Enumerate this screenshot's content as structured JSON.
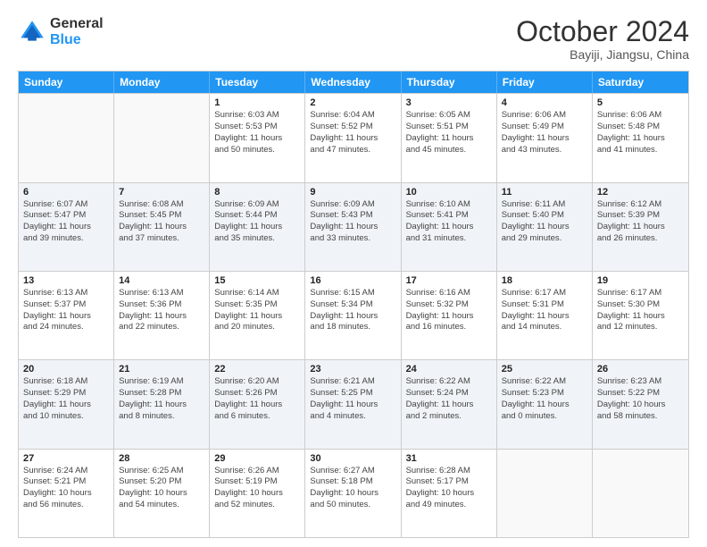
{
  "logo": {
    "line1": "General",
    "line2": "Blue"
  },
  "title": "October 2024",
  "subtitle": "Bayiji, Jiangsu, China",
  "header_days": [
    "Sunday",
    "Monday",
    "Tuesday",
    "Wednesday",
    "Thursday",
    "Friday",
    "Saturday"
  ],
  "weeks": [
    [
      {
        "day": "",
        "lines": []
      },
      {
        "day": "",
        "lines": []
      },
      {
        "day": "1",
        "lines": [
          "Sunrise: 6:03 AM",
          "Sunset: 5:53 PM",
          "Daylight: 11 hours",
          "and 50 minutes."
        ]
      },
      {
        "day": "2",
        "lines": [
          "Sunrise: 6:04 AM",
          "Sunset: 5:52 PM",
          "Daylight: 11 hours",
          "and 47 minutes."
        ]
      },
      {
        "day": "3",
        "lines": [
          "Sunrise: 6:05 AM",
          "Sunset: 5:51 PM",
          "Daylight: 11 hours",
          "and 45 minutes."
        ]
      },
      {
        "day": "4",
        "lines": [
          "Sunrise: 6:06 AM",
          "Sunset: 5:49 PM",
          "Daylight: 11 hours",
          "and 43 minutes."
        ]
      },
      {
        "day": "5",
        "lines": [
          "Sunrise: 6:06 AM",
          "Sunset: 5:48 PM",
          "Daylight: 11 hours",
          "and 41 minutes."
        ]
      }
    ],
    [
      {
        "day": "6",
        "lines": [
          "Sunrise: 6:07 AM",
          "Sunset: 5:47 PM",
          "Daylight: 11 hours",
          "and 39 minutes."
        ]
      },
      {
        "day": "7",
        "lines": [
          "Sunrise: 6:08 AM",
          "Sunset: 5:45 PM",
          "Daylight: 11 hours",
          "and 37 minutes."
        ]
      },
      {
        "day": "8",
        "lines": [
          "Sunrise: 6:09 AM",
          "Sunset: 5:44 PM",
          "Daylight: 11 hours",
          "and 35 minutes."
        ]
      },
      {
        "day": "9",
        "lines": [
          "Sunrise: 6:09 AM",
          "Sunset: 5:43 PM",
          "Daylight: 11 hours",
          "and 33 minutes."
        ]
      },
      {
        "day": "10",
        "lines": [
          "Sunrise: 6:10 AM",
          "Sunset: 5:41 PM",
          "Daylight: 11 hours",
          "and 31 minutes."
        ]
      },
      {
        "day": "11",
        "lines": [
          "Sunrise: 6:11 AM",
          "Sunset: 5:40 PM",
          "Daylight: 11 hours",
          "and 29 minutes."
        ]
      },
      {
        "day": "12",
        "lines": [
          "Sunrise: 6:12 AM",
          "Sunset: 5:39 PM",
          "Daylight: 11 hours",
          "and 26 minutes."
        ]
      }
    ],
    [
      {
        "day": "13",
        "lines": [
          "Sunrise: 6:13 AM",
          "Sunset: 5:37 PM",
          "Daylight: 11 hours",
          "and 24 minutes."
        ]
      },
      {
        "day": "14",
        "lines": [
          "Sunrise: 6:13 AM",
          "Sunset: 5:36 PM",
          "Daylight: 11 hours",
          "and 22 minutes."
        ]
      },
      {
        "day": "15",
        "lines": [
          "Sunrise: 6:14 AM",
          "Sunset: 5:35 PM",
          "Daylight: 11 hours",
          "and 20 minutes."
        ]
      },
      {
        "day": "16",
        "lines": [
          "Sunrise: 6:15 AM",
          "Sunset: 5:34 PM",
          "Daylight: 11 hours",
          "and 18 minutes."
        ]
      },
      {
        "day": "17",
        "lines": [
          "Sunrise: 6:16 AM",
          "Sunset: 5:32 PM",
          "Daylight: 11 hours",
          "and 16 minutes."
        ]
      },
      {
        "day": "18",
        "lines": [
          "Sunrise: 6:17 AM",
          "Sunset: 5:31 PM",
          "Daylight: 11 hours",
          "and 14 minutes."
        ]
      },
      {
        "day": "19",
        "lines": [
          "Sunrise: 6:17 AM",
          "Sunset: 5:30 PM",
          "Daylight: 11 hours",
          "and 12 minutes."
        ]
      }
    ],
    [
      {
        "day": "20",
        "lines": [
          "Sunrise: 6:18 AM",
          "Sunset: 5:29 PM",
          "Daylight: 11 hours",
          "and 10 minutes."
        ]
      },
      {
        "day": "21",
        "lines": [
          "Sunrise: 6:19 AM",
          "Sunset: 5:28 PM",
          "Daylight: 11 hours",
          "and 8 minutes."
        ]
      },
      {
        "day": "22",
        "lines": [
          "Sunrise: 6:20 AM",
          "Sunset: 5:26 PM",
          "Daylight: 11 hours",
          "and 6 minutes."
        ]
      },
      {
        "day": "23",
        "lines": [
          "Sunrise: 6:21 AM",
          "Sunset: 5:25 PM",
          "Daylight: 11 hours",
          "and 4 minutes."
        ]
      },
      {
        "day": "24",
        "lines": [
          "Sunrise: 6:22 AM",
          "Sunset: 5:24 PM",
          "Daylight: 11 hours",
          "and 2 minutes."
        ]
      },
      {
        "day": "25",
        "lines": [
          "Sunrise: 6:22 AM",
          "Sunset: 5:23 PM",
          "Daylight: 11 hours",
          "and 0 minutes."
        ]
      },
      {
        "day": "26",
        "lines": [
          "Sunrise: 6:23 AM",
          "Sunset: 5:22 PM",
          "Daylight: 10 hours",
          "and 58 minutes."
        ]
      }
    ],
    [
      {
        "day": "27",
        "lines": [
          "Sunrise: 6:24 AM",
          "Sunset: 5:21 PM",
          "Daylight: 10 hours",
          "and 56 minutes."
        ]
      },
      {
        "day": "28",
        "lines": [
          "Sunrise: 6:25 AM",
          "Sunset: 5:20 PM",
          "Daylight: 10 hours",
          "and 54 minutes."
        ]
      },
      {
        "day": "29",
        "lines": [
          "Sunrise: 6:26 AM",
          "Sunset: 5:19 PM",
          "Daylight: 10 hours",
          "and 52 minutes."
        ]
      },
      {
        "day": "30",
        "lines": [
          "Sunrise: 6:27 AM",
          "Sunset: 5:18 PM",
          "Daylight: 10 hours",
          "and 50 minutes."
        ]
      },
      {
        "day": "31",
        "lines": [
          "Sunrise: 6:28 AM",
          "Sunset: 5:17 PM",
          "Daylight: 10 hours",
          "and 49 minutes."
        ]
      },
      {
        "day": "",
        "lines": []
      },
      {
        "day": "",
        "lines": []
      }
    ]
  ]
}
